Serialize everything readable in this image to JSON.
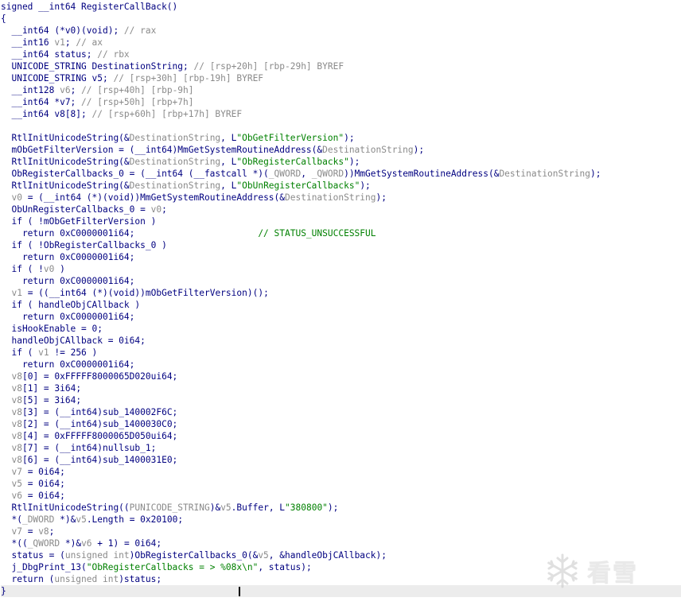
{
  "lines": [
    [
      [
        "signed __int64 RegisterCallBack()",
        "k"
      ]
    ],
    [
      [
        "{",
        "k"
      ]
    ],
    [
      [
        "  __int64 (*v0)(void); ",
        "k"
      ],
      [
        "// rax",
        "g"
      ]
    ],
    [
      [
        "  __int16 ",
        "k"
      ],
      [
        "v1",
        "g"
      ],
      [
        "; ",
        "k"
      ],
      [
        "// ax",
        "g"
      ]
    ],
    [
      [
        "  __int64 status; ",
        "k"
      ],
      [
        "// rbx",
        "g"
      ]
    ],
    [
      [
        "  UNICODE_STRING DestinationString; ",
        "k"
      ],
      [
        "// [rsp+20h] [rbp-29h] BYREF",
        "g"
      ]
    ],
    [
      [
        "  UNICODE_STRING v5; ",
        "k"
      ],
      [
        "// [rsp+30h] [rbp-19h] BYREF",
        "g"
      ]
    ],
    [
      [
        "  __int128 ",
        "k"
      ],
      [
        "v6",
        "g"
      ],
      [
        "; ",
        "k"
      ],
      [
        "// [rsp+40h] [rbp-9h]",
        "g"
      ]
    ],
    [
      [
        "  __int64 *v7; ",
        "k"
      ],
      [
        "// [rsp+50h] [rbp+7h]",
        "g"
      ]
    ],
    [
      [
        "  __int64 v8[8]; ",
        "k"
      ],
      [
        "// [rsp+60h] [rbp+17h] BYREF",
        "g"
      ]
    ],
    [
      [
        "",
        "k"
      ]
    ],
    [
      [
        "  RtlInitUnicodeString(&",
        "k"
      ],
      [
        "DestinationString",
        "g"
      ],
      [
        ", L",
        "k"
      ],
      [
        "\"ObGetFilterVersion\"",
        "s"
      ],
      [
        ");",
        "k"
      ]
    ],
    [
      [
        "  mObGetFilterVersion = (__int64)MmGetSystemRoutineAddress(&",
        "k"
      ],
      [
        "DestinationString",
        "g"
      ],
      [
        ");",
        "k"
      ]
    ],
    [
      [
        "  RtlInitUnicodeString(&",
        "k"
      ],
      [
        "DestinationString",
        "g"
      ],
      [
        ", L",
        "k"
      ],
      [
        "\"ObRegisterCallbacks\"",
        "s"
      ],
      [
        ");",
        "k"
      ]
    ],
    [
      [
        "  ObRegisterCallbacks_0 = (__int64 (__fastcall *)(",
        "k"
      ],
      [
        "_QWORD",
        "g"
      ],
      [
        ", ",
        "k"
      ],
      [
        "_QWORD",
        "g"
      ],
      [
        "))MmGetSystemRoutineAddress(&",
        "k"
      ],
      [
        "DestinationString",
        "g"
      ],
      [
        ");",
        "k"
      ]
    ],
    [
      [
        "  RtlInitUnicodeString(&",
        "k"
      ],
      [
        "DestinationString",
        "g"
      ],
      [
        ", L",
        "k"
      ],
      [
        "\"ObUnRegisterCallbacks\"",
        "s"
      ],
      [
        ");",
        "k"
      ]
    ],
    [
      [
        "  ",
        "k"
      ],
      [
        "v0",
        "g"
      ],
      [
        " = (__int64 (*)(void))MmGetSystemRoutineAddress(&",
        "k"
      ],
      [
        "DestinationString",
        "g"
      ],
      [
        ");",
        "k"
      ]
    ],
    [
      [
        "  ObUnRegisterCallbacks_0 = ",
        "k"
      ],
      [
        "v0",
        "g"
      ],
      [
        ";",
        "k"
      ]
    ],
    [
      [
        "  if ( !mObGetFilterVersion )",
        "k"
      ]
    ],
    [
      [
        "    return 0xC0000001i64;                       ",
        "k"
      ],
      [
        "// STATUS_UNSUCCESSFUL",
        "c"
      ]
    ],
    [
      [
        "  if ( !ObRegisterCallbacks_0 )",
        "k"
      ]
    ],
    [
      [
        "    return 0xC0000001i64;",
        "k"
      ]
    ],
    [
      [
        "  if ( !",
        "k"
      ],
      [
        "v0",
        "g"
      ],
      [
        " )",
        "k"
      ]
    ],
    [
      [
        "    return 0xC0000001i64;",
        "k"
      ]
    ],
    [
      [
        "  ",
        "k"
      ],
      [
        "v1",
        "g"
      ],
      [
        " = ((__int64 (*)(void))mObGetFilterVersion)();",
        "k"
      ]
    ],
    [
      [
        "  if ( handleObjCAllback )",
        "k"
      ]
    ],
    [
      [
        "    return 0xC0000001i64;",
        "k"
      ]
    ],
    [
      [
        "  isHookEnable = 0;",
        "k"
      ]
    ],
    [
      [
        "  handleObjCAllback = 0i64;",
        "k"
      ]
    ],
    [
      [
        "  if ( ",
        "k"
      ],
      [
        "v1",
        "g"
      ],
      [
        " != 256 )",
        "k"
      ]
    ],
    [
      [
        "    return 0xC0000001i64;",
        "k"
      ]
    ],
    [
      [
        "  ",
        "k"
      ],
      [
        "v8",
        "g"
      ],
      [
        "[0] = 0xFFFFF8000065D020ui64;",
        "k"
      ]
    ],
    [
      [
        "  ",
        "k"
      ],
      [
        "v8",
        "g"
      ],
      [
        "[1] = 3i64;",
        "k"
      ]
    ],
    [
      [
        "  ",
        "k"
      ],
      [
        "v8",
        "g"
      ],
      [
        "[5] = 3i64;",
        "k"
      ]
    ],
    [
      [
        "  ",
        "k"
      ],
      [
        "v8",
        "g"
      ],
      [
        "[3] = (__int64)sub_140002F6C;",
        "k"
      ]
    ],
    [
      [
        "  ",
        "k"
      ],
      [
        "v8",
        "g"
      ],
      [
        "[2] = (__int64)sub_1400030C0;",
        "k"
      ]
    ],
    [
      [
        "  ",
        "k"
      ],
      [
        "v8",
        "g"
      ],
      [
        "[4] = 0xFFFFF8000065D050ui64;",
        "k"
      ]
    ],
    [
      [
        "  ",
        "k"
      ],
      [
        "v8",
        "g"
      ],
      [
        "[7] = (__int64)nullsub_1;",
        "k"
      ]
    ],
    [
      [
        "  ",
        "k"
      ],
      [
        "v8",
        "g"
      ],
      [
        "[6] = (__int64)sub_1400031E0;",
        "k"
      ]
    ],
    [
      [
        "  ",
        "k"
      ],
      [
        "v7",
        "g"
      ],
      [
        " = 0i64;",
        "k"
      ]
    ],
    [
      [
        "  ",
        "k"
      ],
      [
        "v5",
        "g"
      ],
      [
        " = 0i64;",
        "k"
      ]
    ],
    [
      [
        "  ",
        "k"
      ],
      [
        "v6",
        "g"
      ],
      [
        " = 0i64;",
        "k"
      ]
    ],
    [
      [
        "  RtlInitUnicodeString((",
        "k"
      ],
      [
        "PUNICODE_STRING",
        "g"
      ],
      [
        ")&",
        "k"
      ],
      [
        "v5",
        "g"
      ],
      [
        ".Buffer, L",
        "k"
      ],
      [
        "\"380800\"",
        "s"
      ],
      [
        ");",
        "k"
      ]
    ],
    [
      [
        "  *(",
        "k"
      ],
      [
        "_DWORD",
        "g"
      ],
      [
        " *)&",
        "k"
      ],
      [
        "v5",
        "g"
      ],
      [
        ".Length = 0x20100;",
        "k"
      ]
    ],
    [
      [
        "  ",
        "k"
      ],
      [
        "v7",
        "g"
      ],
      [
        " = ",
        "k"
      ],
      [
        "v8",
        "g"
      ],
      [
        ";",
        "k"
      ]
    ],
    [
      [
        "  *((",
        "k"
      ],
      [
        "_QWORD",
        "g"
      ],
      [
        " *)&",
        "k"
      ],
      [
        "v6",
        "g"
      ],
      [
        " + 1) = 0i64;",
        "k"
      ]
    ],
    [
      [
        "  status = (",
        "k"
      ],
      [
        "unsigned int",
        "g"
      ],
      [
        ")ObRegisterCallbacks_0(&",
        "k"
      ],
      [
        "v5",
        "g"
      ],
      [
        ", &handleObjCAllback);",
        "k"
      ]
    ],
    [
      [
        "  j_DbgPrint_13(",
        "k"
      ],
      [
        "\"ObRegisterCallbacks = > %08x\\n\"",
        "s"
      ],
      [
        ", status);",
        "k"
      ]
    ],
    [
      [
        "  return (",
        "k"
      ],
      [
        "unsigned int",
        "g"
      ],
      [
        ")status;",
        "k"
      ]
    ],
    [
      [
        "}",
        "k"
      ]
    ]
  ],
  "current_line_index": 49,
  "watermark": {
    "text": "看雪",
    "icon": "snowflake-icon"
  }
}
